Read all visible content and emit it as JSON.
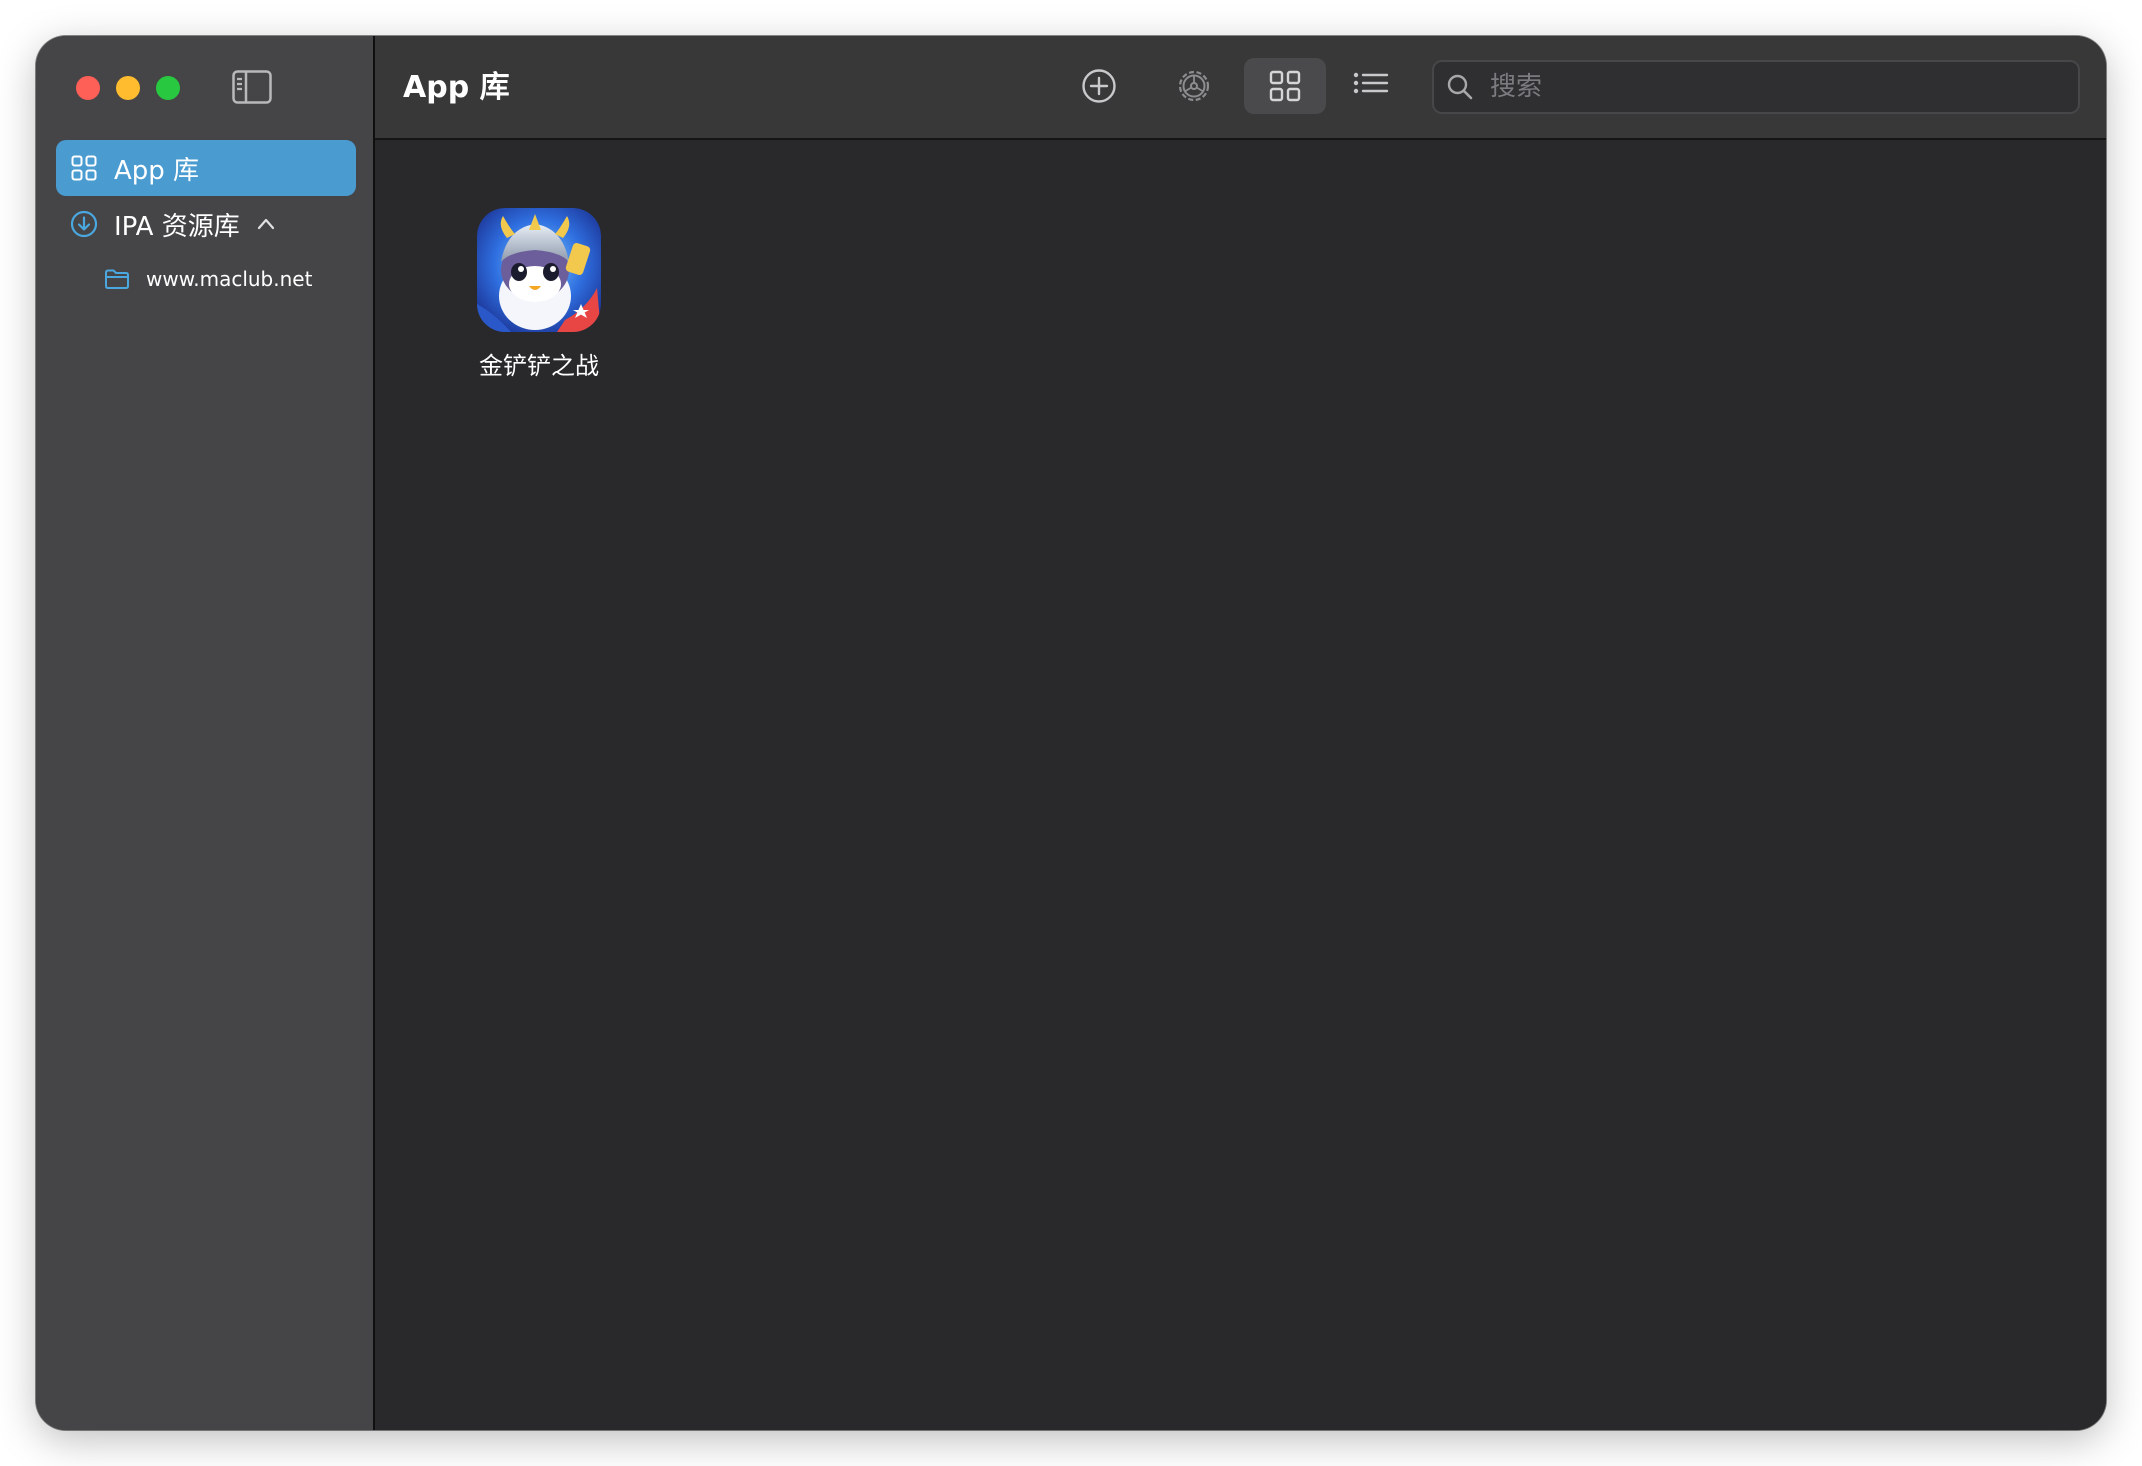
{
  "window": {
    "title": "App 库"
  },
  "sidebar": {
    "items": [
      {
        "label": "App 库",
        "icon": "grid-icon",
        "selected": true
      },
      {
        "label": "IPA 资源库",
        "icon": "download-circle-icon",
        "expanded": true,
        "children": [
          {
            "label": "www.maclub.net",
            "icon": "folder-icon"
          }
        ]
      }
    ]
  },
  "toolbar": {
    "add_icon": "plus-circle-icon",
    "settings_icon": "gear-icon",
    "grid_view_icon": "grid-icon",
    "list_view_icon": "list-icon",
    "active_view": "grid"
  },
  "search": {
    "placeholder": "搜索",
    "value": ""
  },
  "apps": [
    {
      "name": "金铲铲之战",
      "icon": "penguin-app-icon"
    }
  ],
  "colors": {
    "accent": "#4a9bd0",
    "sidebar_bg": "#454547",
    "toolbar_bg": "#383839",
    "content_bg": "#29292c",
    "close": "#fe5f57",
    "minimize": "#febc2e",
    "maximize": "#28c840"
  }
}
